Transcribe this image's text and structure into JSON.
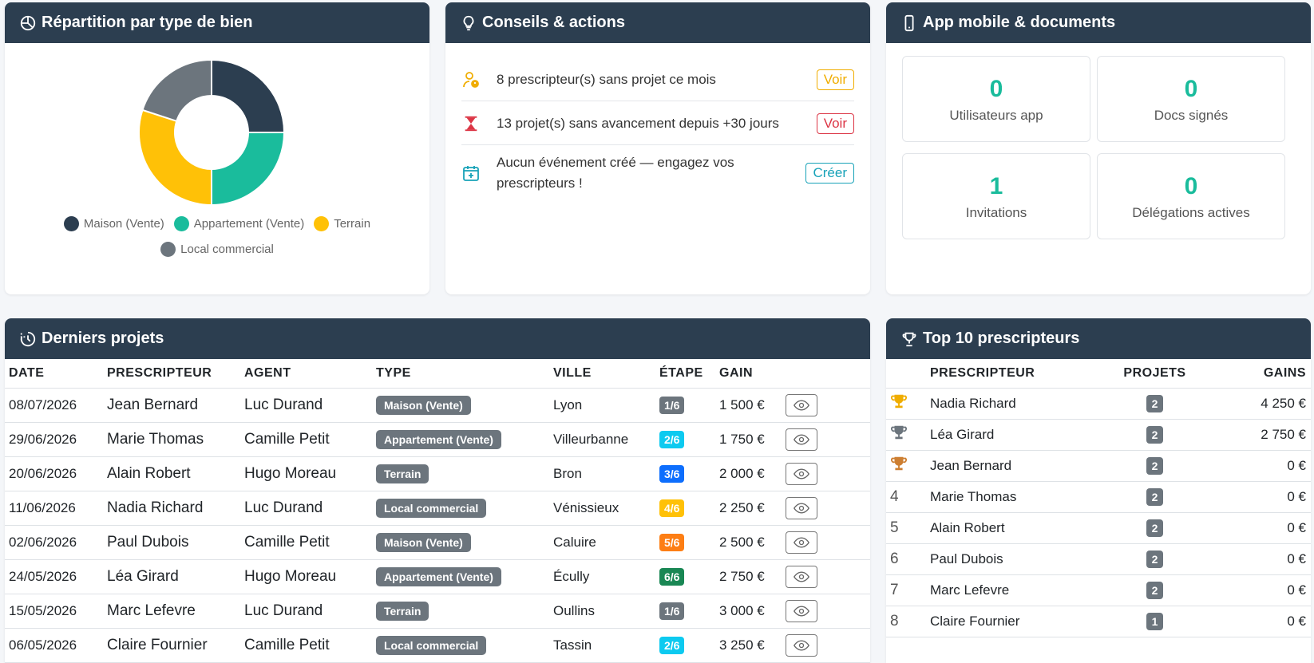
{
  "donut": {
    "title": "Répartition par type de bien",
    "slices": [
      {
        "label": "Maison (Vente)",
        "value": 25,
        "color": "#2c3e50"
      },
      {
        "label": "Appartement (Vente)",
        "value": 25,
        "color": "#1abc9c"
      },
      {
        "label": "Terrain",
        "value": 30,
        "color": "#ffc107"
      },
      {
        "label": "Local commercial",
        "value": 20,
        "color": "#6c757d"
      }
    ]
  },
  "conseils": {
    "title": "Conseils & actions",
    "items": [
      {
        "text": "8 prescripteur(s) sans projet ce mois",
        "action": "Voir",
        "color": "#f0ad00",
        "icon": "user-warning-icon"
      },
      {
        "text": "13 projet(s) sans avancement depuis +30 jours",
        "action": "Voir",
        "color": "#dc3545",
        "icon": "hourglass-icon"
      },
      {
        "text": "Aucun événement créé — engagez vos prescripteurs !",
        "action": "Créer",
        "color": "#17a2b8",
        "icon": "calendar-plus-icon"
      }
    ]
  },
  "app": {
    "title": "App mobile & documents",
    "stats": [
      {
        "value": "0",
        "label": "Utilisateurs app"
      },
      {
        "value": "0",
        "label": "Docs signés"
      },
      {
        "value": "1",
        "label": "Invitations"
      },
      {
        "value": "0",
        "label": "Délégations actives"
      }
    ]
  },
  "projects": {
    "title": "Derniers projets",
    "headers": [
      "DATE",
      "PRESCRIPTEUR",
      "AGENT",
      "TYPE",
      "VILLE",
      "ÉTAPE",
      "GAIN"
    ],
    "rows": [
      {
        "date": "08/07/2026",
        "prescripteur": "Jean Bernard",
        "agent": "Luc Durand",
        "type": "Maison (Vente)",
        "ville": "Lyon",
        "etape": "1/6",
        "etape_color": "#6c757d",
        "gain": "1 500 €"
      },
      {
        "date": "29/06/2026",
        "prescripteur": "Marie Thomas",
        "agent": "Camille Petit",
        "type": "Appartement (Vente)",
        "ville": "Villeurbanne",
        "etape": "2/6",
        "etape_color": "#0dcaf0",
        "gain": "1 750 €"
      },
      {
        "date": "20/06/2026",
        "prescripteur": "Alain Robert",
        "agent": "Hugo Moreau",
        "type": "Terrain",
        "ville": "Bron",
        "etape": "3/6",
        "etape_color": "#0d6efd",
        "gain": "2 000 €"
      },
      {
        "date": "11/06/2026",
        "prescripteur": "Nadia Richard",
        "agent": "Luc Durand",
        "type": "Local commercial",
        "ville": "Vénissieux",
        "etape": "4/6",
        "etape_color": "#ffc107",
        "gain": "2 250 €"
      },
      {
        "date": "02/06/2026",
        "prescripteur": "Paul Dubois",
        "agent": "Camille Petit",
        "type": "Maison (Vente)",
        "ville": "Caluire",
        "etape": "5/6",
        "etape_color": "#fd7e14",
        "gain": "2 500 €"
      },
      {
        "date": "24/05/2026",
        "prescripteur": "Léa Girard",
        "agent": "Hugo Moreau",
        "type": "Appartement (Vente)",
        "ville": "Écully",
        "etape": "6/6",
        "etape_color": "#198754",
        "gain": "2 750 €"
      },
      {
        "date": "15/05/2026",
        "prescripteur": "Marc Lefevre",
        "agent": "Luc Durand",
        "type": "Terrain",
        "ville": "Oullins",
        "etape": "1/6",
        "etape_color": "#6c757d",
        "gain": "3 000 €"
      },
      {
        "date": "06/05/2026",
        "prescripteur": "Claire Fournier",
        "agent": "Camille Petit",
        "type": "Local commercial",
        "ville": "Tassin",
        "etape": "2/6",
        "etape_color": "#0dcaf0",
        "gain": "3 250 €"
      }
    ]
  },
  "top": {
    "title": "Top 10 prescripteurs",
    "headers": [
      "PRESCRIPTEUR",
      "PROJETS",
      "GAINS"
    ],
    "rows": [
      {
        "rank": "trophy-gold-icon",
        "name": "Nadia Richard",
        "projets": "2",
        "gains": "4 250 €"
      },
      {
        "rank": "trophy-silver-icon",
        "name": "Léa Girard",
        "projets": "2",
        "gains": "2 750 €"
      },
      {
        "rank": "trophy-bronze-icon",
        "name": "Jean Bernard",
        "projets": "2",
        "gains": "0 €"
      },
      {
        "rank": "4",
        "name": "Marie Thomas",
        "projets": "2",
        "gains": "0 €"
      },
      {
        "rank": "5",
        "name": "Alain Robert",
        "projets": "2",
        "gains": "0 €"
      },
      {
        "rank": "6",
        "name": "Paul Dubois",
        "projets": "2",
        "gains": "0 €"
      },
      {
        "rank": "7",
        "name": "Marc Lefevre",
        "projets": "2",
        "gains": "0 €"
      },
      {
        "rank": "8",
        "name": "Claire Fournier",
        "projets": "1",
        "gains": "0 €"
      }
    ]
  }
}
